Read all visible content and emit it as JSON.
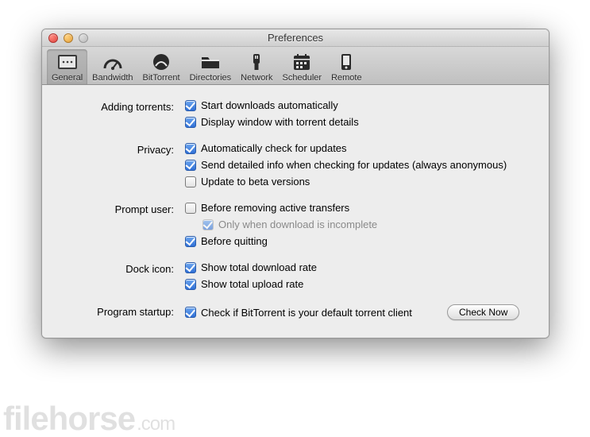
{
  "window": {
    "title": "Preferences"
  },
  "toolbar": [
    {
      "id": "general",
      "label": "General",
      "selected": true
    },
    {
      "id": "bandwidth",
      "label": "Bandwidth",
      "selected": false
    },
    {
      "id": "bittorrent",
      "label": "BitTorrent",
      "selected": false
    },
    {
      "id": "directories",
      "label": "Directories",
      "selected": false
    },
    {
      "id": "network",
      "label": "Network",
      "selected": false
    },
    {
      "id": "scheduler",
      "label": "Scheduler",
      "selected": false
    },
    {
      "id": "remote",
      "label": "Remote",
      "selected": false
    }
  ],
  "sections": {
    "adding": {
      "label": "Adding torrents:"
    },
    "privacy": {
      "label": "Privacy:"
    },
    "prompt": {
      "label": "Prompt user:"
    },
    "dock": {
      "label": "Dock icon:"
    },
    "startup": {
      "label": "Program startup:"
    }
  },
  "options": {
    "start_downloads": {
      "label": "Start downloads automatically",
      "checked": true
    },
    "display_window": {
      "label": "Display window with torrent details",
      "checked": true
    },
    "check_updates": {
      "label": "Automatically check for updates",
      "checked": true
    },
    "send_info": {
      "label": "Send detailed info when checking for updates (always anonymous)",
      "checked": true
    },
    "beta": {
      "label": "Update to beta versions",
      "checked": false
    },
    "before_remove": {
      "label": "Before removing active transfers",
      "checked": false
    },
    "only_incomplete": {
      "label": "Only when download is incomplete",
      "checked": true,
      "disabled": true
    },
    "before_quit": {
      "label": "Before quitting",
      "checked": true
    },
    "show_download": {
      "label": "Show total download rate",
      "checked": true
    },
    "show_upload": {
      "label": "Show total upload rate",
      "checked": true
    },
    "default_client": {
      "label": "Check if BitTorrent is your default torrent client",
      "checked": true
    }
  },
  "buttons": {
    "check_now": "Check Now"
  },
  "watermark": {
    "brand": "filehorse",
    "domain": ".com"
  }
}
